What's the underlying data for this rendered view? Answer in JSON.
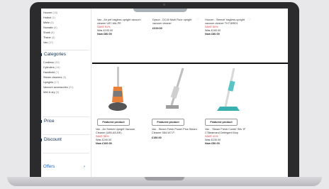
{
  "sidebar": {
    "brands": [
      {
        "name": "Hoover",
        "count": "(16)"
      },
      {
        "name": "Hotbot",
        "count": "(1)"
      },
      {
        "name": "Miele",
        "count": "(5)"
      },
      {
        "name": "Numatic",
        "count": "(6)"
      },
      {
        "name": "Shark",
        "count": "(8)"
      },
      {
        "name": "Thane",
        "count": "(5)"
      },
      {
        "name": "Vax",
        "count": "(37)"
      }
    ],
    "categories_heading": "Categories",
    "categories": [
      {
        "name": "Cordless",
        "count": "(33)"
      },
      {
        "name": "Cylinders",
        "count": "(14)"
      },
      {
        "name": "Handheld",
        "count": "(7)"
      },
      {
        "name": "Steam cleaners",
        "count": "(5)"
      },
      {
        "name": "Uprights",
        "count": "(17)"
      },
      {
        "name": "Vacuum accessories",
        "count": "(21)"
      },
      {
        "name": "Wet & dry",
        "count": "(5)"
      }
    ],
    "price_heading": "Price",
    "discount_heading": "Discount",
    "offers_label": "Offers",
    "offers_chevron": "›"
  },
  "products_row1": [
    {
      "name": "Vax - Air pet bagless upright vacuum cleaner U87-MA-PE",
      "sale": "SAVE 51%",
      "was": "Was £190.00",
      "now": "Now £80.00"
    },
    {
      "name": "Dyson - DC40 Multi Floor upright vacuum cleaner",
      "sale": "",
      "was": "",
      "now": "£319.00"
    },
    {
      "name": "Hoover - 'Breeze' bagless upright vacuum cleaner TH71BR01",
      "sale": "SAVE 50%",
      "was": "Was £160.00",
      "now": "Now £80.00"
    }
  ],
  "products_row2": [
    {
      "badge": "Featured product",
      "name": "Vax - Air Stretch Upright Vacuum Cleaner (U85-AS-BE)",
      "sale": "SAVE 58%",
      "was": "Was £240.00",
      "now": "Now £100.00"
    },
    {
      "badge": "Featured product",
      "name": "Vax - Steam Fresh Power Plus Steam Cleaner S84-W7-P",
      "sale": "",
      "was": "",
      "now": "£150.00"
    },
    {
      "badge": "Featured product",
      "name": "Vax - 'Steam Fresh Combi' Silk 'iF' C'Steamand Detergent Mop",
      "sale": "SAVE 41%",
      "was": "Was £130.00",
      "now": "Now £50.00"
    }
  ],
  "icons": {
    "wishlist": "heart-icon"
  },
  "colors": {
    "sale": "#e0343a",
    "heading": "#0d2b4a",
    "link": "#1b63c4"
  }
}
